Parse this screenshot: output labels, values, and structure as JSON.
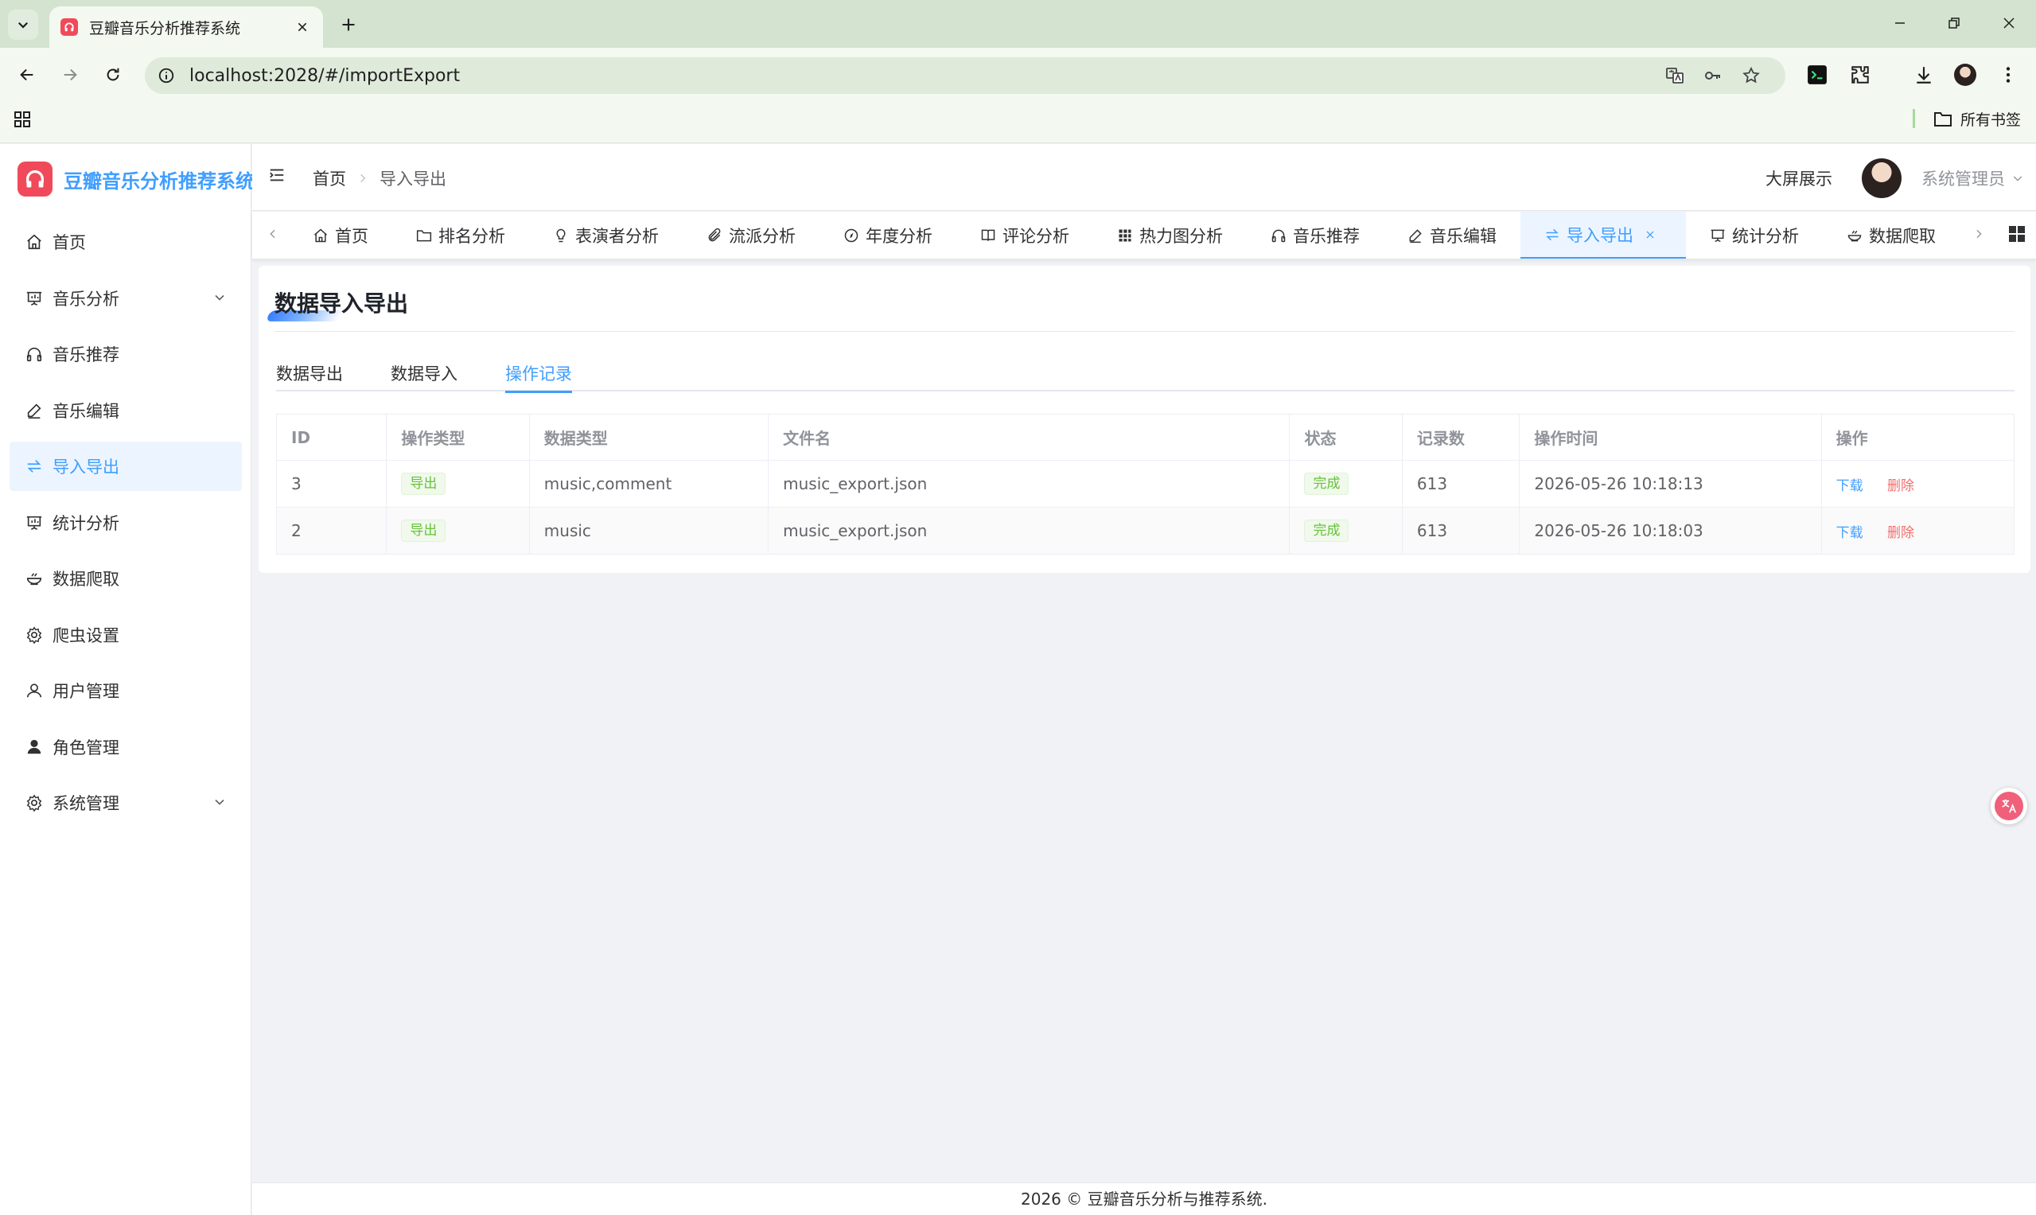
{
  "browser": {
    "tab_title": "豆瓣音乐分析推荐系统",
    "url_host": "localhost",
    "url_rest": ":2028/#/importExport",
    "bookmarks_all": "所有书签"
  },
  "app": {
    "logo_text": "豆瓣音乐分析推荐系统",
    "accent_color": "#409eff",
    "logo_color": "#f04a5a"
  },
  "sidebar": {
    "items": [
      {
        "label": "首页",
        "icon": "home-icon"
      },
      {
        "label": "音乐分析",
        "icon": "presentation-icon",
        "expandable": true
      },
      {
        "label": "音乐推荐",
        "icon": "headphones-icon"
      },
      {
        "label": "音乐编辑",
        "icon": "edit-pen-icon"
      },
      {
        "label": "导入导出",
        "icon": "switch-icon",
        "active": true
      },
      {
        "label": "统计分析",
        "icon": "presentation-icon"
      },
      {
        "label": "数据爬取",
        "icon": "bowl-icon"
      },
      {
        "label": "爬虫设置",
        "icon": "gear-icon"
      },
      {
        "label": "用户管理",
        "icon": "user-icon"
      },
      {
        "label": "角色管理",
        "icon": "user-filled-icon"
      },
      {
        "label": "系统管理",
        "icon": "gear-icon",
        "expandable": true
      }
    ]
  },
  "header": {
    "breadcrumb": [
      "首页",
      "导入导出"
    ],
    "bigscreen": "大屏展示",
    "username": "系统管理员"
  },
  "tags": [
    {
      "label": "首页",
      "icon": "home-icon"
    },
    {
      "label": "排名分析",
      "icon": "folder-icon"
    },
    {
      "label": "表演者分析",
      "icon": "bulb-icon"
    },
    {
      "label": "流派分析",
      "icon": "paperclip-icon"
    },
    {
      "label": "年度分析",
      "icon": "compass-icon"
    },
    {
      "label": "评论分析",
      "icon": "book-icon"
    },
    {
      "label": "热力图分析",
      "icon": "grid-icon"
    },
    {
      "label": "音乐推荐",
      "icon": "headphones-icon"
    },
    {
      "label": "音乐编辑",
      "icon": "edit-pen-icon"
    },
    {
      "label": "导入导出",
      "icon": "switch-icon",
      "active": true
    },
    {
      "label": "统计分析",
      "icon": "presentation-icon"
    },
    {
      "label": "数据爬取",
      "icon": "bowl-icon"
    }
  ],
  "page": {
    "title": "数据导入导出",
    "sub_tabs": [
      {
        "label": "数据导出"
      },
      {
        "label": "数据导入"
      },
      {
        "label": "操作记录",
        "active": true
      }
    ],
    "table": {
      "headers": [
        "ID",
        "操作类型",
        "数据类型",
        "文件名",
        "状态",
        "记录数",
        "操作时间",
        "操作"
      ],
      "rows": [
        {
          "id": "3",
          "op_type": "导出",
          "data_type": "music,comment",
          "file": "music_export.json",
          "status": "完成",
          "count": "613",
          "time": "2026-05-26 10:18:13",
          "download": "下载",
          "delete": "删除"
        },
        {
          "id": "2",
          "op_type": "导出",
          "data_type": "music",
          "file": "music_export.json",
          "status": "完成",
          "count": "613",
          "time": "2026-05-26 10:18:03",
          "download": "下载",
          "delete": "删除"
        }
      ]
    }
  },
  "footer": {
    "text": "2026 © 豆瓣音乐分析与推荐系统."
  }
}
